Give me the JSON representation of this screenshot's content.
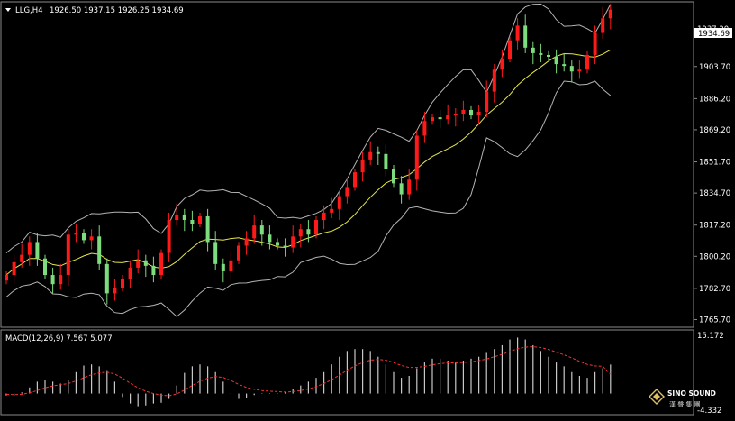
{
  "header": {
    "symbol_tf": "LLG,H4",
    "ohlc": "1926.50 1937.15 1926.25 1934.69"
  },
  "macd": {
    "label": "MACD(12,26,9) 7.567 5.077",
    "axis_top": "15.172",
    "axis_bottom": "-4.332"
  },
  "price_axis": {
    "labels": [
      "1920.70",
      "1903.70",
      "1886.20",
      "1869.20",
      "1851.70",
      "1834.70",
      "1817.20",
      "1800.20",
      "1782.70",
      "1765.70"
    ],
    "current_price": "1934.69",
    "top_partial": "1937.20"
  },
  "watermark": {
    "brand": "SINO SOUND",
    "cn": "漢 聲 集 團"
  },
  "colors": {
    "background": "#000000",
    "bull_candle": "#ff1a1a",
    "bear_candle": "#7ddc7d",
    "bands": "#b4b4b4",
    "ma": "#e6e64a",
    "macd_hist": "#c8c8c8",
    "macd_signal": "#ff3030",
    "axis_text": "#ffffff"
  },
  "chart_data": {
    "type": "candlestick",
    "price_range": [
      1762,
      1938
    ],
    "closes": [
      1790,
      1797,
      1801,
      1808,
      1799,
      1790,
      1785,
      1790,
      1812,
      1813,
      1809,
      1811,
      1796,
      1780,
      1783,
      1788,
      1794,
      1798,
      1795,
      1790,
      1802,
      1820,
      1823,
      1820,
      1818,
      1822,
      1808,
      1796,
      1792,
      1798,
      1806,
      1810,
      1817,
      1812,
      1808,
      1806,
      1805,
      1811,
      1815,
      1812,
      1820,
      1824,
      1826,
      1833,
      1838,
      1846,
      1853,
      1857,
      1856,
      1848,
      1840,
      1834,
      1842,
      1866,
      1874,
      1876,
      1875,
      1877,
      1878,
      1880,
      1877,
      1879,
      1890,
      1902,
      1908,
      1918,
      1926,
      1914,
      1911,
      1910,
      1909,
      1905,
      1904,
      1901,
      1902,
      1910,
      1922,
      1930,
      1934.69
    ],
    "macd_hist": [
      -0.5,
      -0.6,
      0.3,
      1.6,
      3.1,
      3.6,
      3.1,
      2.6,
      3.4,
      5.6,
      7.3,
      7.6,
      7.1,
      6.1,
      3.1,
      -0.9,
      -2.6,
      -3.3,
      -3.1,
      -2.6,
      -2.4,
      -1.4,
      2.1,
      5.4,
      7.1,
      7.6,
      7.1,
      5.6,
      3.1,
      0.1,
      -1.4,
      -1.1,
      -0.4,
      -0.1,
      0.1,
      -0.1,
      0.3,
      1.1,
      2.1,
      3.1,
      4.1,
      5.6,
      7.6,
      9.6,
      11.1,
      11.6,
      11.6,
      11.1,
      9.6,
      7.6,
      5.6,
      4.1,
      4.6,
      6.6,
      8.1,
      9.1,
      9.1,
      8.6,
      8.1,
      8.6,
      9.1,
      9.6,
      10.6,
      11.6,
      12.6,
      14.1,
      14.6,
      14.1,
      12.6,
      11.1,
      9.6,
      8.1,
      7.1,
      5.6,
      4.6,
      4.1,
      5.6,
      6.6,
      7.567
    ],
    "macd_signal": [
      -0.2,
      -0.3,
      -0.2,
      0.2,
      0.8,
      1.5,
      2.0,
      2.3,
      2.6,
      3.3,
      4.1,
      4.9,
      5.4,
      5.6,
      5.1,
      4.0,
      2.7,
      1.5,
      0.6,
      0,
      -0.4,
      -0.6,
      -0.1,
      0.9,
      2.1,
      3.2,
      4.0,
      4.4,
      4.2,
      3.4,
      2.4,
      1.6,
      1.1,
      0.8,
      0.6,
      0.5,
      0.4,
      0.5,
      0.8,
      1.2,
      1.8,
      2.6,
      3.6,
      4.8,
      6.1,
      7.2,
      8.1,
      8.7,
      8.9,
      8.7,
      8.1,
      7.3,
      6.8,
      6.8,
      7.1,
      7.5,
      7.8,
      8.0,
      8.0,
      8.1,
      8.3,
      8.6,
      9.0,
      9.6,
      10.2,
      11.0,
      11.7,
      12.1,
      12.2,
      12.0,
      11.5,
      10.8,
      10.1,
      9.3,
      8.4,
      7.6,
      7.2,
      7.1,
      5.077
    ],
    "macd_range": [
      -4.332,
      15.172
    ]
  }
}
